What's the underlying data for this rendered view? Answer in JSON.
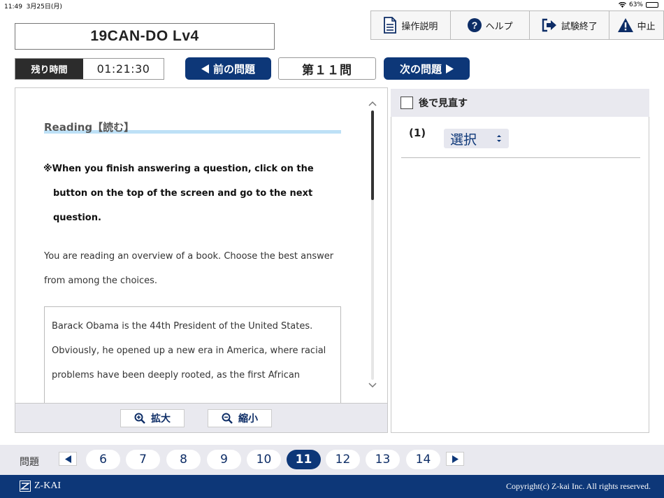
{
  "status_bar": {
    "time": "11:49",
    "date": "3月25日(月)",
    "battery": "63%",
    "battery_level": 0.63
  },
  "exam_title": "19CAN-DO Lv4",
  "toolbar": {
    "instructions": "操作説明",
    "help": "ヘルプ",
    "end_exam": "試験終了",
    "abort": "中止"
  },
  "timer": {
    "label": "残り時間",
    "value": "01:21:30"
  },
  "nav": {
    "prev": "前の問題",
    "question_number": "第１１問",
    "next": "次の問題"
  },
  "reading": {
    "section_title": "Reading【読む】",
    "instruction_line1": "※When you finish answering a question, click on the",
    "instruction_line2": "button on the top of the screen and go to the next",
    "instruction_line3": "question.",
    "direction": "You are reading an overview of a book. Choose the best answer from among the choices.",
    "passage": "Barack Obama is the 44th President of the United States. Obviously, he opened up a new era in America, where racial problems have been deeply rooted, as the first African"
  },
  "zoom": {
    "zoom_in": "拡大",
    "zoom_out": "縮小"
  },
  "answer": {
    "review_later": "後で見直す",
    "question_label": "(1)",
    "select_value": "選択"
  },
  "pager": {
    "label": "問題",
    "pages": [
      "6",
      "7",
      "8",
      "9",
      "10",
      "11",
      "12",
      "13",
      "14"
    ],
    "current": "11"
  },
  "footer": {
    "logo": "Z-KAI",
    "copyright": "Copyright(c) Z-kai Inc. All rights reserved."
  },
  "colors": {
    "navy": "#0d3778",
    "panel_gray": "#e9e9ef",
    "underline_blue": "#bde0f6"
  }
}
